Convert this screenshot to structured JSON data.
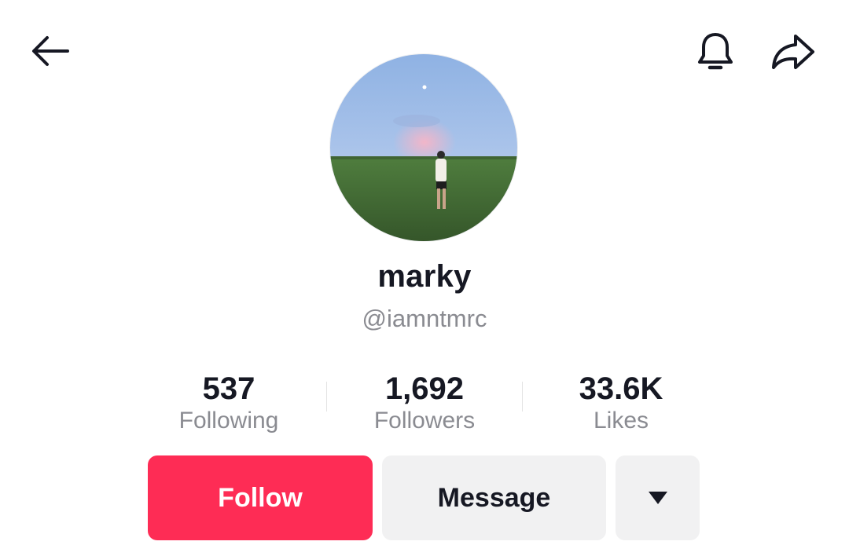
{
  "header": {
    "back_icon": "arrow-left-icon",
    "bell_icon": "bell-icon",
    "share_icon": "share-arrow-icon"
  },
  "profile": {
    "display_name": "marky",
    "handle": "@iamntmrc"
  },
  "stats": [
    {
      "value": "537",
      "label": "Following"
    },
    {
      "value": "1,692",
      "label": "Followers"
    },
    {
      "value": "33.6K",
      "label": "Likes"
    }
  ],
  "actions": {
    "follow_label": "Follow",
    "message_label": "Message",
    "more_icon": "caret-down-icon"
  },
  "colors": {
    "accent": "#fe2c55",
    "secondary_button": "#f1f1f2",
    "text_primary": "#161823",
    "text_secondary": "#8a8b91"
  }
}
